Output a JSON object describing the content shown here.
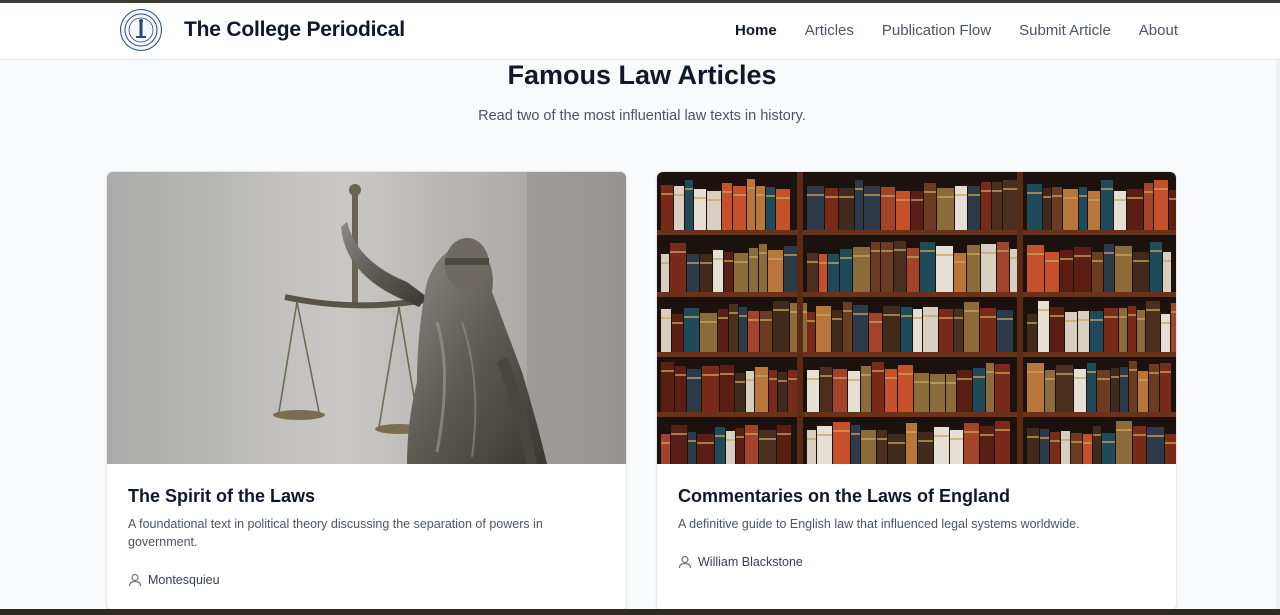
{
  "header": {
    "brand": "The College Periodical",
    "logo_icon": "college-seal-icon",
    "nav": [
      {
        "label": "Home",
        "active": true
      },
      {
        "label": "Articles",
        "active": false
      },
      {
        "label": "Publication Flow",
        "active": false
      },
      {
        "label": "Submit Article",
        "active": false
      },
      {
        "label": "About",
        "active": false
      }
    ]
  },
  "main": {
    "title": "Famous Law Articles",
    "subtitle": "Read two of the most influential law texts in history."
  },
  "cards": [
    {
      "title": "The Spirit of the Laws",
      "description": "A foundational text in political theory discussing the separation of powers in government.",
      "author": "Montesquieu",
      "image": "lady-justice-statue-photo",
      "author_icon": "user-icon"
    },
    {
      "title": "Commentaries on the Laws of England",
      "description": "A definitive guide to English law that influenced legal systems worldwide.",
      "author": "William Blackstone",
      "image": "law-library-bookshelf-photo",
      "author_icon": "user-icon"
    }
  ],
  "colors": {
    "primary_text": "#0f172a",
    "muted_text": "#4b5563",
    "background": "#f8fafc",
    "card_border": "#e5e7eb"
  }
}
